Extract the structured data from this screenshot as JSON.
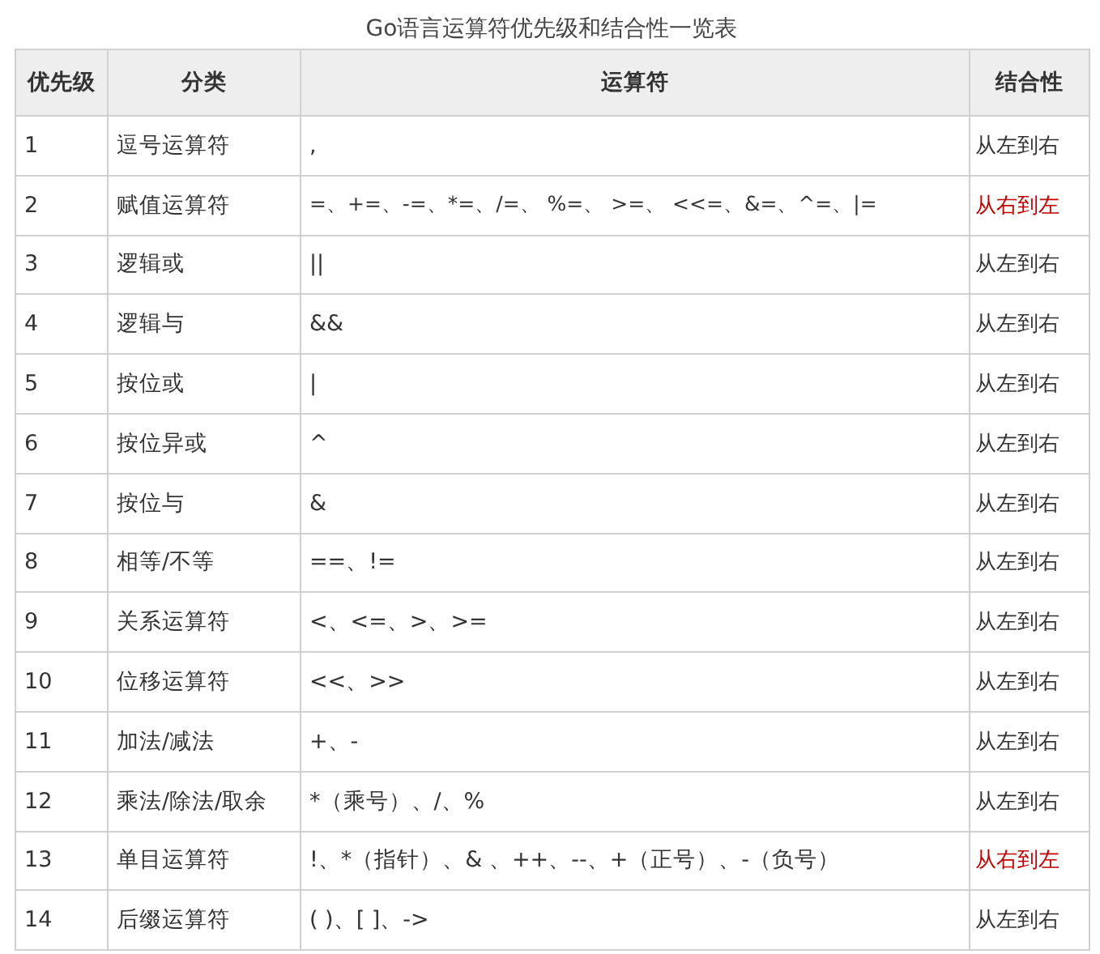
{
  "title": "Go语言运算符优先级和结合性一览表",
  "table": {
    "columns": [
      "优先级",
      "分类",
      "运算符",
      "结合性"
    ],
    "rows": [
      {
        "priority": "1",
        "category": "逗号运算符",
        "operators": ",",
        "associativity": "从左到右",
        "color": "#333333"
      },
      {
        "priority": "2",
        "category": "赋值运算符",
        "operators": "=、+=、-=、*=、/=、 %=、 >=、 <<=、&=、^=、|=",
        "associativity": "从右到左",
        "color": "#c00000"
      },
      {
        "priority": "3",
        "category": "逻辑或",
        "operators": "||",
        "associativity": "从左到右",
        "color": "#333333"
      },
      {
        "priority": "4",
        "category": "逻辑与",
        "operators": "&&",
        "associativity": "从左到右",
        "color": "#333333"
      },
      {
        "priority": "5",
        "category": "按位或",
        "operators": "|",
        "associativity": "从左到右",
        "color": "#333333"
      },
      {
        "priority": "6",
        "category": "按位异或",
        "operators": "^",
        "associativity": "从左到右",
        "color": "#333333"
      },
      {
        "priority": "7",
        "category": "按位与",
        "operators": "&",
        "associativity": "从左到右",
        "color": "#333333"
      },
      {
        "priority": "8",
        "category": "相等/不等",
        "operators": "==、!=",
        "associativity": "从左到右",
        "color": "#333333"
      },
      {
        "priority": "9",
        "category": "关系运算符",
        "operators": "<、<=、>、>=",
        "associativity": "从左到右",
        "color": "#333333"
      },
      {
        "priority": "10",
        "category": "位移运算符",
        "operators": "<<、>>",
        "associativity": "从左到右",
        "color": "#333333"
      },
      {
        "priority": "11",
        "category": "加法/减法",
        "operators": "+、-",
        "associativity": "从左到右",
        "color": "#333333"
      },
      {
        "priority": "12",
        "category": "乘法/除法/取余",
        "operators": "*（乘号）、/、%",
        "associativity": "从左到右",
        "color": "#333333"
      },
      {
        "priority": "13",
        "category": "单目运算符",
        "operators": "!、*（指针）、& 、++、--、+（正号）、-（负号）",
        "associativity": "从右到左",
        "color": "#c00000"
      },
      {
        "priority": "14",
        "category": "后缀运算符",
        "operators": "( )、[ ]、->",
        "associativity": "从左到右",
        "color": "#333333"
      }
    ]
  }
}
